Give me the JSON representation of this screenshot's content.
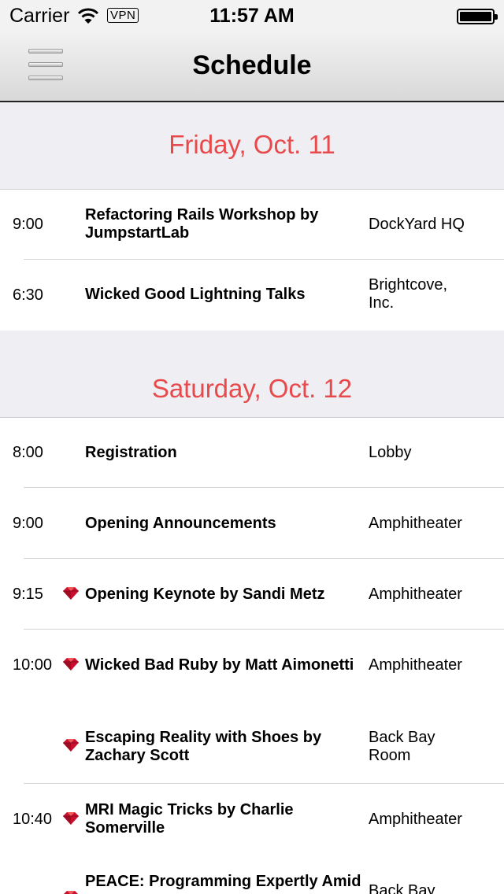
{
  "status": {
    "carrier": "Carrier",
    "vpn": "VPN",
    "time": "11:57 AM"
  },
  "nav": {
    "title": "Schedule"
  },
  "sections": [
    {
      "day": "Friday, Oct. 11",
      "items": [
        {
          "time": "9:00",
          "title": "Refactoring Rails Workshop by JumpstartLab",
          "location": "DockYard HQ"
        },
        {
          "time": "6:30",
          "title": "Wicked Good Lightning Talks",
          "location": "Brightcove, Inc."
        }
      ]
    },
    {
      "day": "Saturday, Oct. 12",
      "items": [
        {
          "time": "8:00",
          "title": "Registration",
          "location": "Lobby"
        },
        {
          "time": "9:00",
          "title": "Opening Announcements",
          "location": "Amphitheater"
        },
        {
          "time": "9:15",
          "title": "Opening Keynote by Sandi Metz",
          "location": "Amphitheater",
          "icon": "ruby-gem-icon"
        },
        {
          "time": "10:00",
          "title": "Wicked Bad Ruby by Matt Aimonetti",
          "location": "Amphitheater",
          "icon": "ruby-gem-icon"
        },
        {
          "time": "",
          "title": "Escaping Reality with Shoes by Zachary Scott",
          "location": "Back Bay Room",
          "icon": "ruby-gem-icon"
        },
        {
          "time": "10:40",
          "title": "MRI Magic Tricks by Charlie Somerville",
          "location": "Amphitheater",
          "icon": "ruby-gem-icon"
        },
        {
          "time": "",
          "title": "PEACE: Programming Expertly Amid",
          "location": "Back Bay",
          "icon": "ruby-gem-icon"
        }
      ]
    }
  ],
  "colors": {
    "accent": "#e84a4c",
    "section_bg": "#eeeef3"
  }
}
